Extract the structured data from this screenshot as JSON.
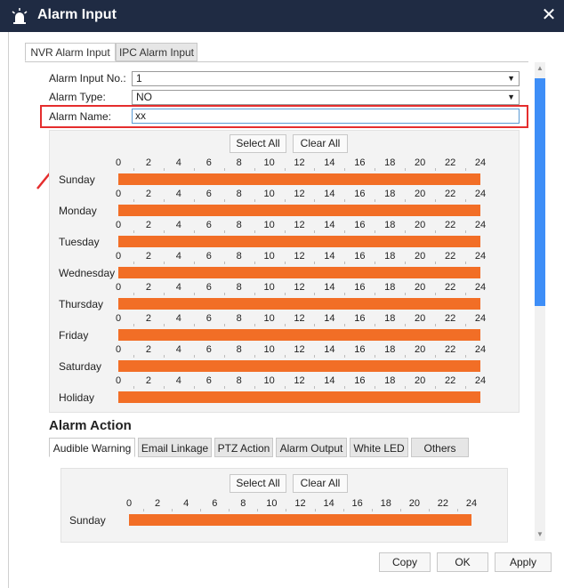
{
  "window": {
    "title": "Alarm Input",
    "close_glyph": "✕"
  },
  "tabs": [
    {
      "label": "NVR Alarm Input",
      "active": true
    },
    {
      "label": "IPC Alarm Input",
      "active": false
    }
  ],
  "form": {
    "alarm_input_no": {
      "label": "Alarm Input No.:",
      "value": "1"
    },
    "alarm_type": {
      "label": "Alarm Type:",
      "value": "NO"
    },
    "alarm_name": {
      "label": "Alarm Name:",
      "value": "xx"
    }
  },
  "schedule": {
    "select_all": "Select All",
    "clear_all": "Clear All",
    "hours": [
      "0",
      "2",
      "4",
      "6",
      "8",
      "10",
      "12",
      "14",
      "16",
      "18",
      "20",
      "22",
      "24"
    ],
    "days": [
      "Sunday",
      "Monday",
      "Tuesday",
      "Wednesday",
      "Thursday",
      "Friday",
      "Saturday",
      "Holiday"
    ],
    "bar_color": "#f26e26",
    "coverage_fraction": 1.0
  },
  "alarm_action": {
    "title": "Alarm Action",
    "tabs": [
      {
        "label": "Audible Warning",
        "active": true
      },
      {
        "label": "Email Linkage",
        "active": false
      },
      {
        "label": "PTZ Action",
        "active": false
      },
      {
        "label": "Alarm Output",
        "active": false
      },
      {
        "label": "White LED",
        "active": false
      },
      {
        "label": "Others",
        "active": false
      }
    ],
    "select_all": "Select All",
    "clear_all": "Clear All",
    "days": [
      "Sunday"
    ]
  },
  "footer": {
    "copy": "Copy",
    "ok": "OK",
    "apply": "Apply"
  },
  "colors": {
    "title_bar": "#1f2b43",
    "accent": "#3e8ef7",
    "highlight": "#e52d2d"
  }
}
